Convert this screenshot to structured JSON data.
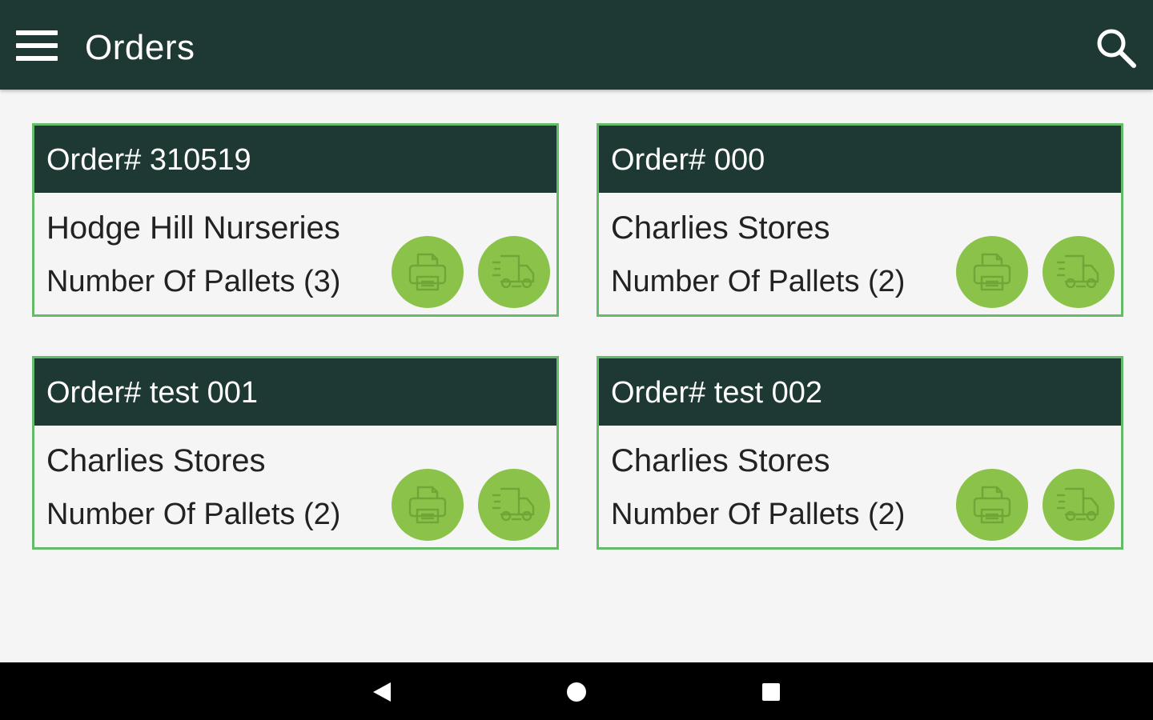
{
  "appbar": {
    "title": "Orders",
    "menu_icon": "hamburger-menu-icon",
    "search_icon": "search-icon"
  },
  "orders": [
    {
      "order": "Order# 310519",
      "customer": "Hodge Hill Nurseries",
      "pallets": "Number Of Pallets (3)"
    },
    {
      "order": "Order# 000",
      "customer": "Charlies Stores",
      "pallets": "Number Of Pallets (2)"
    },
    {
      "order": "Order# test 001",
      "customer": "Charlies Stores",
      "pallets": "Number Of Pallets (2)"
    },
    {
      "order": "Order# test 002",
      "customer": "Charlies Stores",
      "pallets": "Number Of Pallets (2)"
    }
  ],
  "card_actions": {
    "print_icon": "printer-icon",
    "deliver_icon": "delivery-truck-icon"
  },
  "navigation_bar": {
    "back_icon": "back-triangle-icon",
    "home_icon": "home-circle-icon",
    "recent_icon": "recent-apps-square-icon"
  },
  "colors": {
    "primary_dark": "#1e3833",
    "accent_green": "#8bc34a",
    "card_border": "#66bb6a",
    "background": "#f5f5f5"
  }
}
